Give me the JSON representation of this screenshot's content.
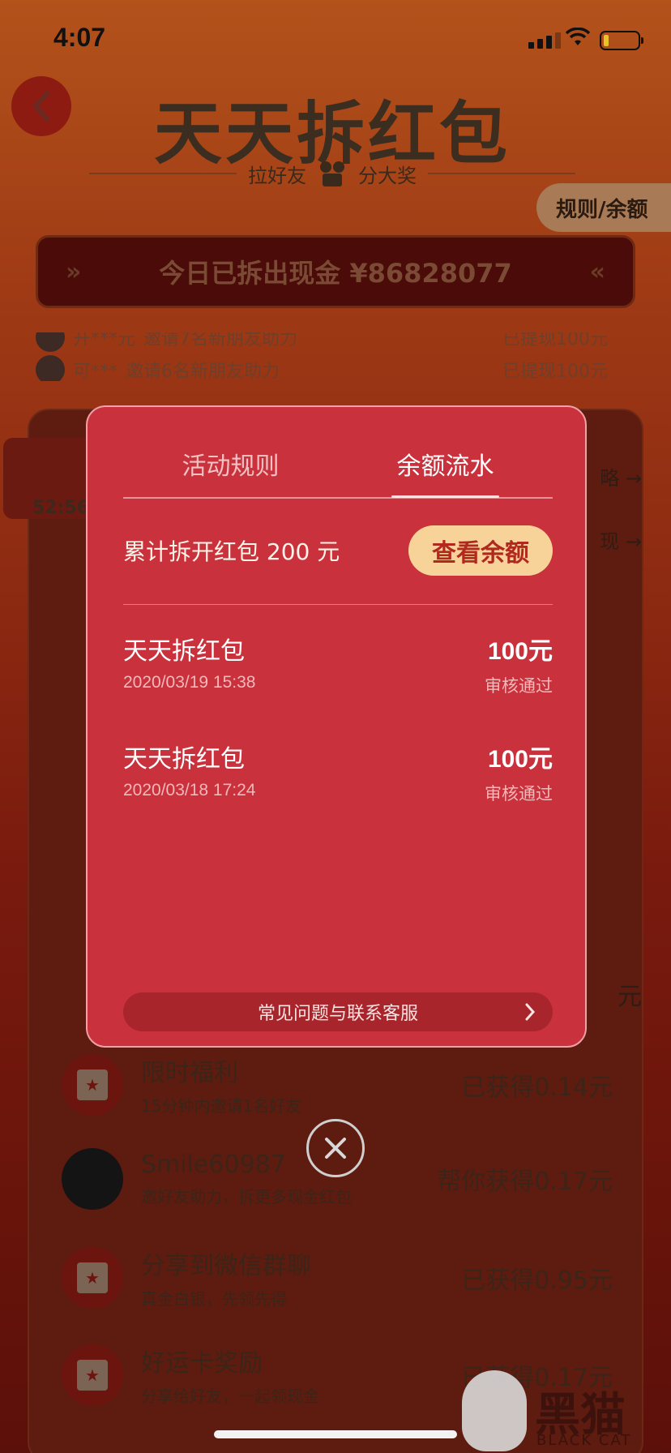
{
  "status_bar": {
    "time": "4:07"
  },
  "header": {
    "title": "天天拆红包",
    "subtitle_left": "拉好友",
    "subtitle_right": "分大奖",
    "rules_link": "规则/余额"
  },
  "cash_banner": {
    "text": "今日已拆出现金 ¥86828077"
  },
  "ticker": [
    {
      "user": "开***元",
      "action": "邀请7名新朋友助力",
      "result": "已提现100元"
    },
    {
      "user": "可***",
      "action": "邀请6名新朋友助力",
      "result": "已提现100元"
    }
  ],
  "background": {
    "timer": "52:56",
    "side_links": [
      "略",
      "现"
    ],
    "rows": [
      {
        "title": "限时福利",
        "desc": "15分钟内邀请1名好友",
        "amount": "已获得0.14元",
        "icon": "star-bookmark-icon"
      },
      {
        "title": "Smile60987",
        "desc": "邀好友助力，拆更多现金红包",
        "amount": "帮你获得0.17元",
        "icon": "avatar"
      },
      {
        "title": "分享到微信群聊",
        "desc": "真金白银，先领先得",
        "amount": "已获得0.95元",
        "icon": "star-bookmark-icon"
      },
      {
        "title": "好运卡奖励",
        "desc": "分享给好友，一起领现金",
        "amount": "已获得0.17元",
        "icon": "star-bookmark-icon"
      }
    ],
    "partial_amount": "元"
  },
  "modal": {
    "tabs": [
      {
        "label": "活动规则",
        "active": false
      },
      {
        "label": "余额流水",
        "active": true
      }
    ],
    "summary_label": "累计拆开红包 200 元",
    "check_balance_button": "查看余额",
    "entries": [
      {
        "name": "天天拆红包",
        "date": "2020/03/19 15:38",
        "amount": "100元",
        "status": "审核通过"
      },
      {
        "name": "天天拆红包",
        "date": "2020/03/18 17:24",
        "amount": "100元",
        "status": "审核通过"
      }
    ],
    "faq_link": "常见问题与联系客服"
  },
  "watermark": {
    "text": "黑猫",
    "sub": "BLACK CAT"
  },
  "colors": {
    "modal_bg": "#c9313c",
    "button_bg": "#f7d39a",
    "button_text": "#b0281e"
  }
}
